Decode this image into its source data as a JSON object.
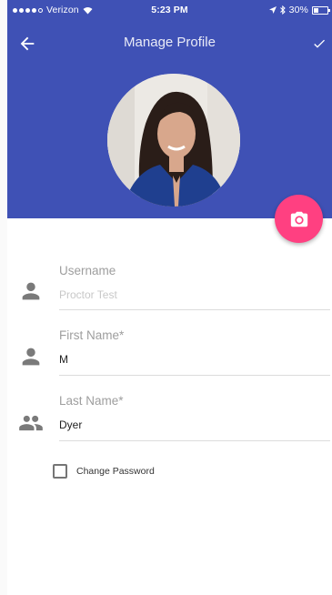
{
  "status_bar": {
    "carrier": "Verizon",
    "time": "5:23 PM",
    "battery": "30%"
  },
  "toolbar": {
    "title": "Manage Profile"
  },
  "fields": [
    {
      "label": "Username",
      "value": "Proctor Test",
      "is_placeholder": true
    },
    {
      "label": "First Name*",
      "value": "M",
      "is_placeholder": false
    },
    {
      "label": "Last Name*",
      "value": "Dyer",
      "is_placeholder": false
    }
  ],
  "change_password": {
    "label": "Change Password",
    "checked": false
  },
  "colors": {
    "header": "#3f51b5",
    "fab": "#ff4081"
  }
}
